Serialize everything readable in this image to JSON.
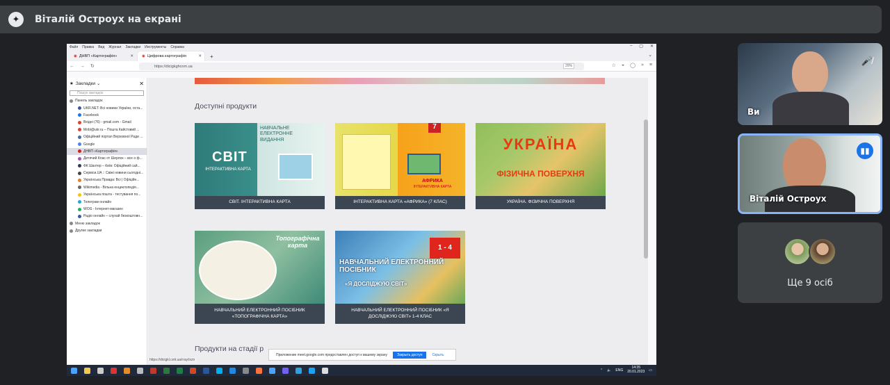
{
  "meet": {
    "presenter_title": "Віталій Остроух на екрані",
    "self_label": "Ви",
    "speaker_label": "Віталій Остроух",
    "more_label": "Ще 9 осіб"
  },
  "browser": {
    "menu": [
      "Файл",
      "Правка",
      "Вид",
      "Журнал",
      "Закладки",
      "Инструменты",
      "Справка"
    ],
    "tabs": [
      {
        "label": "ДНВП «Картографія»",
        "active": false
      },
      {
        "label": "Цифрова картографія",
        "active": true
      }
    ],
    "url": "https://dicigkghcom.ua",
    "zoom": "20%",
    "status_url": "https://dicigkl.ceti.ua/rray/ixzn"
  },
  "sidebar": {
    "header": "Закладки",
    "search_placeholder": "Пошук закладок",
    "items": [
      "Панель закладок",
      "UKR.NET: Всі новини України, оста...",
      "Facebook",
      "Вхідні (76) - gmail.com - Gmail",
      "Mobi@ukr.ru – Пошта Кайстовий ...",
      "Офіційний портал Верховної Ради ...",
      "Google",
      "ДНВП «Картографія»",
      "Дитячий Клас от Шерлок – все о ф...",
      "ФК Шахтер – Київ: Офіційний сай...",
      "Сервіси.UA :: Свіжі новини сьогодні...",
      "Українська Правда: Всі | Офіційн...",
      "Wikimedia - Вільна енциклопедія...",
      "Українська пошта - тестування по...",
      "Телеграм онлайн",
      "WOG - Інтернет-магазин",
      "Радіо онлайн – слухай безкоштовн...",
      "Меню закладок",
      "Другие закладки"
    ]
  },
  "page": {
    "section_title": "Доступні продукти",
    "section2_title": "Продукти на стадії р",
    "products": [
      {
        "caption": "СВІТ. ІНТЕРАКТИВНА КАРТА",
        "img_title": "СВІТ",
        "img_sub": "ІНТЕРАКТИВНА КАРТА",
        "img_extra": "НАВЧАЛЬНЕ ЕЛЕКТРОННЕ ВИДАННЯ"
      },
      {
        "caption": "ІНТЕРАКТИВНА КАРТА «АФРИКА» (7 КЛАС)",
        "img_title": "АФРИКА",
        "img_sub": "ІНТЕРАКТИВНА КАРТА",
        "img_extra": "7"
      },
      {
        "caption": "УКРАЇНА. ФІЗИЧНА ПОВЕРХНЯ",
        "img_title": "УКРАЇНА",
        "img_sub": "ФІЗИЧНА ПОВЕРХНЯ",
        "img_extra": ""
      },
      {
        "caption": "НАВЧАЛЬНИЙ ЕЛЕКТРОННИЙ ПОСІБНИК «ТОПОГРАФІЧНА КАРТА»",
        "img_title": "Топографічна карта",
        "img_sub": "",
        "img_extra": ""
      },
      {
        "caption": "НАВЧАЛЬНИЙ ЕЛЕКТРОННИЙ ПОСІБНИК «Я ДОСЛІДЖУЮ СВІТ» 1-4 КЛАС",
        "img_title": "НАВЧАЛЬНИЙ ЕЛЕКТРОННИЙ ПОСІБНИК",
        "img_sub": "«Я ДОСЛІДЖУЮ СВІТ»",
        "img_extra": "1 - 4"
      }
    ]
  },
  "notification": {
    "text": "Приложение meet.google.com предоставлен доступ к вашему экрану",
    "action": "Закрыть доступ",
    "hide": "Скрыть"
  },
  "tray": {
    "lang": "ENG",
    "time": "14:35",
    "date": "20.01.2023"
  }
}
